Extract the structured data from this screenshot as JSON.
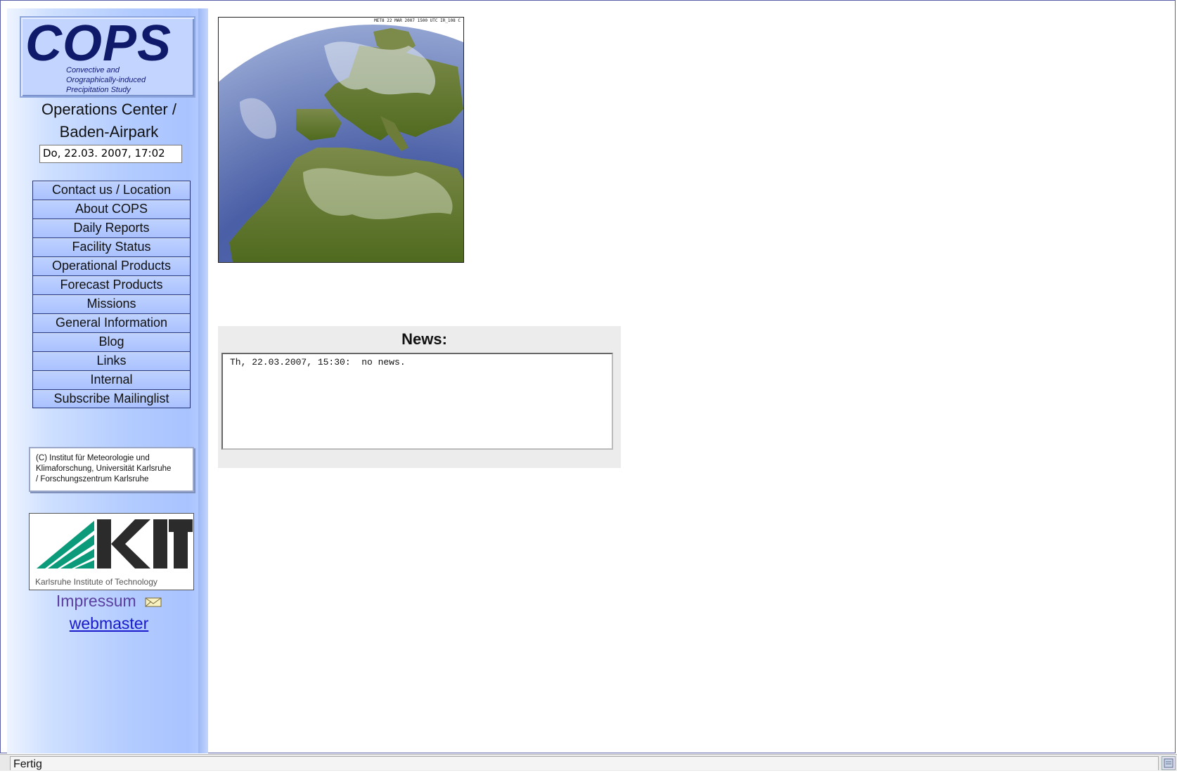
{
  "logo": {
    "title": "COPS",
    "subtitle_line1": "Convective and",
    "subtitle_line2": "Orographically-induced",
    "subtitle_line3": "Precipitation Study"
  },
  "ops_center": {
    "line1": "Operations Center /",
    "line2": "Baden-Airpark"
  },
  "datetime": "Do, 22.03. 2007, 17:02",
  "nav": {
    "items": [
      {
        "label": "Contact us / Location"
      },
      {
        "label": "About COPS"
      },
      {
        "label": "Daily Reports"
      },
      {
        "label": "Facility Status"
      },
      {
        "label": "Operational Products"
      },
      {
        "label": "Forecast Products"
      },
      {
        "label": "Missions"
      },
      {
        "label": "General Information"
      },
      {
        "label": "Blog"
      },
      {
        "label": "Links"
      },
      {
        "label": "Internal"
      },
      {
        "label": "Subscribe Mailinglist"
      }
    ]
  },
  "copyright": {
    "line1": "(C) Institut für Meteorologie und",
    "line2": "Klimaforschung, Universität Karlsruhe",
    "line3": "/ Forschungszentrum Karlsruhe"
  },
  "kit": {
    "caption": "Karlsruhe Institute of Technology"
  },
  "footer_links": {
    "impressum": "Impressum",
    "webmaster": "webmaster"
  },
  "satellite": {
    "header_text": "MET8 22 MAR 2007 1500 UTC IR_108 C"
  },
  "news": {
    "title": "News:",
    "content": "Th, 22.03.2007, 15:30:  no news."
  },
  "status_bar": {
    "text": "Fertig"
  },
  "icons": [
    "mail-icon",
    "kit-logo-icon",
    "status-icon"
  ]
}
